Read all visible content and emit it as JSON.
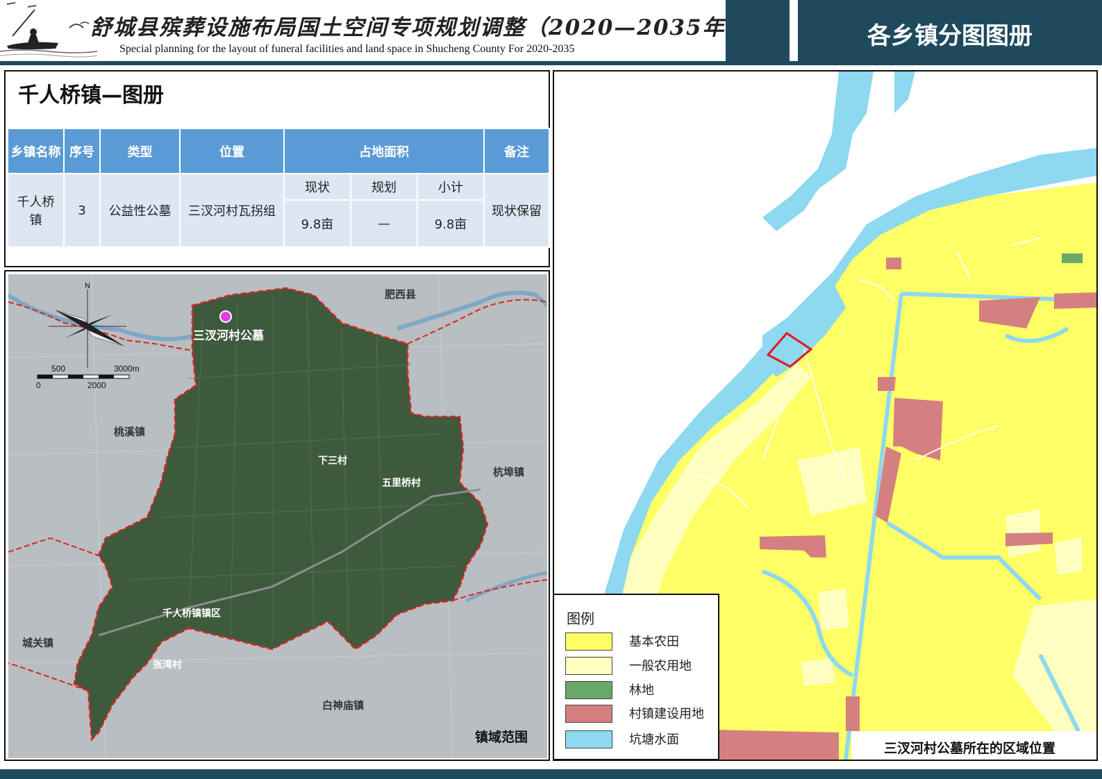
{
  "header": {
    "title_cn": "舒城县殡葬设施布局国土空间专项规划调整（2020—2035年）",
    "title_en": "Special planning for the layout of funeral facilities and land space in Shucheng County For 2020-2035",
    "right_title": "各乡镇分图图册"
  },
  "town": {
    "title": "千人桥镇—图册"
  },
  "table": {
    "headers": {
      "township": "乡镇名称",
      "seq": "序号",
      "type": "类型",
      "location": "位置",
      "area": "占地面积",
      "remark": "备注"
    },
    "sub_headers": {
      "current": "现状",
      "planned": "规划",
      "subtotal": "小计"
    },
    "row": {
      "township": "千人桥镇",
      "seq": "3",
      "type": "公益性公墓",
      "location": "三汊河村瓦拐组",
      "current": "9.8亩",
      "planned": "—",
      "subtotal": "9.8亩",
      "remark": "现状保留"
    }
  },
  "left_map": {
    "north": "N",
    "scale_top_left": "500",
    "scale_top_right": "3000m",
    "scale_bottom_left": "0",
    "scale_bottom_mid": "2000",
    "place_labels": {
      "feixi": "肥西县",
      "taoxi": "桃溪镇",
      "hangbu": "杭埠镇",
      "chengguan": "城关镇",
      "baishenmiao": "白神庙镇",
      "xiasan": "下三村",
      "wuliqiao": "五里桥村",
      "qianrenqiao_town": "千人桥镇镇区",
      "zhangwan": "张湾村",
      "cemetery": "三汊河村公墓"
    },
    "caption": "镇域范围",
    "colors": {
      "boundary": "#e02020",
      "marker": "#e040e0",
      "green": "#3e5a3c",
      "water": "#7fa8c4"
    }
  },
  "right_map": {
    "caption": "三汊河村公墓所在的区域位置",
    "legend": {
      "title": "图例",
      "items": [
        {
          "label": "基本农田",
          "color": "#ffff66"
        },
        {
          "label": "一般农用地",
          "color": "#ffffc0"
        },
        {
          "label": "林地",
          "color": "#6aa86a"
        },
        {
          "label": "村镇建设用地",
          "color": "#d48080"
        },
        {
          "label": "坑塘水面",
          "color": "#8ed8f0"
        }
      ]
    },
    "site_color": "#e8141e"
  }
}
